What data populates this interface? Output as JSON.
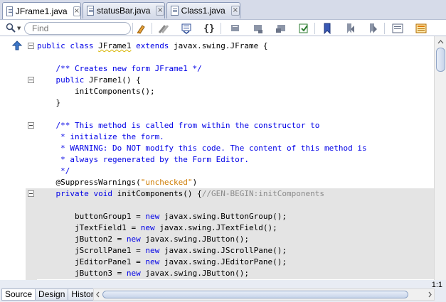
{
  "tabs": [
    {
      "label": "JFrame1.java",
      "active": true
    },
    {
      "label": "statusBar.java",
      "active": false
    },
    {
      "label": "Class1.java",
      "active": false
    }
  ],
  "toolbar": {
    "search_placeholder": "Find",
    "icons": [
      "search-icon",
      "toggle-highlight-icon",
      "previous-bookmark-icon",
      "next-bookmark-icon",
      "toggle-braces-icon",
      "back-icon",
      "forward-icon",
      "history-icon",
      "last-edit-icon",
      "toggle-bookmark-icon",
      "previous-occurrence-icon",
      "next-occurrence-icon",
      "next-bookmark-icon",
      "shift-left-icon",
      "macro-icon"
    ]
  },
  "code_lines": [
    [
      {
        "t": "public class ",
        "c": "kw"
      },
      {
        "t": "JFrame1",
        "c": "plain squig"
      },
      {
        "t": " extends ",
        "c": "kw"
      },
      {
        "t": "javax.swing.JFrame {",
        "c": "plain"
      }
    ],
    [],
    [
      {
        "t": "    /** Creates new form JFrame1 */",
        "c": "cm"
      }
    ],
    [
      {
        "t": "    public ",
        "c": "kw"
      },
      {
        "t": "JFrame1() {",
        "c": "plain"
      }
    ],
    [
      {
        "t": "        initComponents();",
        "c": "plain"
      }
    ],
    [
      {
        "t": "    }",
        "c": "plain"
      }
    ],
    [],
    [
      {
        "t": "    /** This method is called from within the constructor to",
        "c": "cm"
      }
    ],
    [
      {
        "t": "     * initialize the form.",
        "c": "cm"
      }
    ],
    [
      {
        "t": "     * WARNING: Do NOT modify this code. The content of this method is",
        "c": "cm"
      }
    ],
    [
      {
        "t": "     * always regenerated by the Form Editor.",
        "c": "cm"
      }
    ],
    [
      {
        "t": "     */",
        "c": "cm"
      }
    ],
    [
      {
        "t": "    @SuppressWarnings(",
        "c": "plain"
      },
      {
        "t": "\"unchecked\"",
        "c": "str"
      },
      {
        "t": ")",
        "c": "plain"
      }
    ],
    [
      {
        "t": "    private void ",
        "c": "kw"
      },
      {
        "t": "initComponents() {",
        "c": "plain"
      },
      {
        "t": "//GEN-BEGIN:initComponents",
        "c": "cmg"
      }
    ],
    [],
    [
      {
        "t": "        buttonGroup1 = ",
        "c": "plain"
      },
      {
        "t": "new ",
        "c": "kw"
      },
      {
        "t": "javax.swing.ButtonGroup();",
        "c": "plain"
      }
    ],
    [
      {
        "t": "        jTextField1 = ",
        "c": "plain"
      },
      {
        "t": "new ",
        "c": "kw"
      },
      {
        "t": "javax.swing.JTextField();",
        "c": "plain"
      }
    ],
    [
      {
        "t": "        jButton2 = ",
        "c": "plain"
      },
      {
        "t": "new ",
        "c": "kw"
      },
      {
        "t": "javax.swing.JButton();",
        "c": "plain"
      }
    ],
    [
      {
        "t": "        jScrollPane1 = ",
        "c": "plain"
      },
      {
        "t": "new ",
        "c": "kw"
      },
      {
        "t": "javax.swing.JScrollPane();",
        "c": "plain"
      }
    ],
    [
      {
        "t": "        jEditorPane1 = ",
        "c": "plain"
      },
      {
        "t": "new ",
        "c": "kw"
      },
      {
        "t": "javax.swing.JEditorPane();",
        "c": "plain"
      }
    ],
    [
      {
        "t": "        jButton3 = ",
        "c": "plain"
      },
      {
        "t": "new ",
        "c": "kw"
      },
      {
        "t": "javax.swing.JButton();",
        "c": "plain"
      }
    ]
  ],
  "highlighted_from_line": 13,
  "folds_at_lines": [
    0,
    3,
    7,
    13
  ],
  "caret_position": "1:1",
  "bottom_tabs": [
    {
      "label": "Source",
      "active": true
    },
    {
      "label": "Design",
      "active": false
    },
    {
      "label": "History",
      "active": false
    }
  ]
}
